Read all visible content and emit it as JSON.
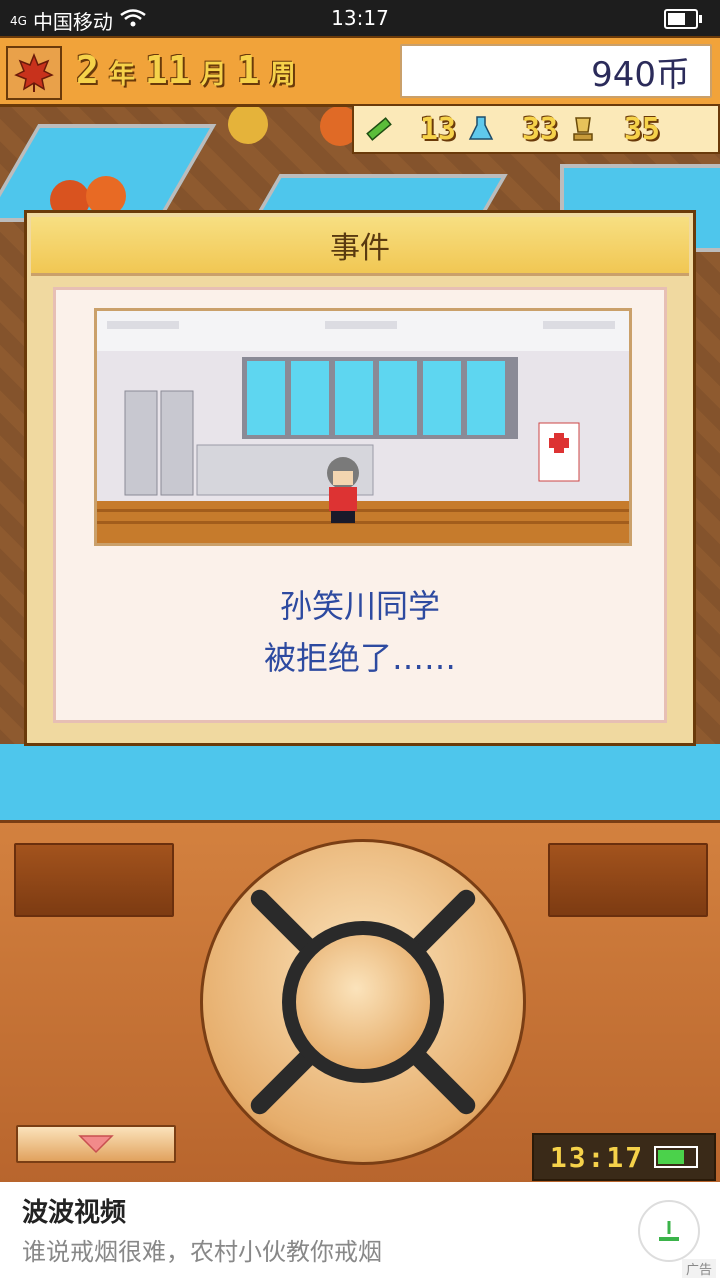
{
  "status_bar": {
    "signal": "4G",
    "carrier": "中国移动",
    "time": "13:17",
    "battery_level": 0.55
  },
  "top_bar": {
    "year": "2",
    "year_unit": "年",
    "month": "11",
    "month_unit": "月",
    "week": "1",
    "week_unit": "周",
    "money": "940币"
  },
  "stats": [
    {
      "icon": "pencil-icon",
      "value": "13"
    },
    {
      "icon": "flask-icon",
      "value": "33"
    },
    {
      "icon": "trophy-icon",
      "value": "35"
    }
  ],
  "dialog": {
    "title": "事件",
    "message_line1": "孙笑川同学",
    "message_line2": "被拒绝了……"
  },
  "device": {
    "clock": "13:17",
    "battery_level": 0.65
  },
  "ad": {
    "name": "波波视频",
    "description": "谁说戒烟很难，农村小伙教你戒烟",
    "tag": "广告"
  },
  "colors": {
    "accent": "#f1a33a",
    "message": "#2d4aa0",
    "wood": "#d3813f"
  }
}
